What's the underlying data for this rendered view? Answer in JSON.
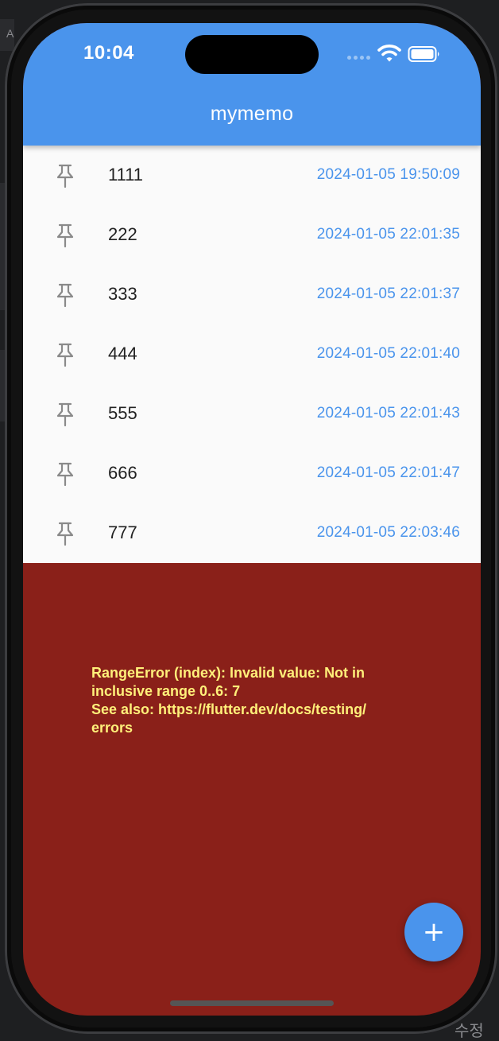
{
  "desktop": {
    "corner_top_text": "A",
    "corner_bottom_text": "수정"
  },
  "status_bar": {
    "time": "10:04",
    "icons": [
      "wifi-icon",
      "battery-icon"
    ]
  },
  "app_bar": {
    "title": "mymemo"
  },
  "memos": [
    {
      "title": "1111",
      "date": "2024-01-05 19:50:09",
      "icon": "pin-icon"
    },
    {
      "title": "222",
      "date": "2024-01-05 22:01:35",
      "icon": "pin-icon"
    },
    {
      "title": "333",
      "date": "2024-01-05 22:01:37",
      "icon": "pin-icon"
    },
    {
      "title": "444",
      "date": "2024-01-05 22:01:40",
      "icon": "pin-icon"
    },
    {
      "title": "555",
      "date": "2024-01-05 22:01:43",
      "icon": "pin-icon"
    },
    {
      "title": "666",
      "date": "2024-01-05 22:01:47",
      "icon": "pin-icon"
    },
    {
      "title": "777",
      "date": "2024-01-05 22:03:46",
      "icon": "pin-icon"
    }
  ],
  "error": {
    "message": "RangeError (index): Invalid value: Not in\ninclusive range 0..6: 7\nSee also: https://flutter.dev/docs/testing/\nerrors"
  },
  "fab": {
    "label": "+",
    "icon": "add-icon"
  },
  "colors": {
    "app_bar": "#4a94ec",
    "accent": "#4a94ec",
    "error_background": "#8a2019",
    "error_text": "#fff07a",
    "list_background": "#fafafa"
  }
}
